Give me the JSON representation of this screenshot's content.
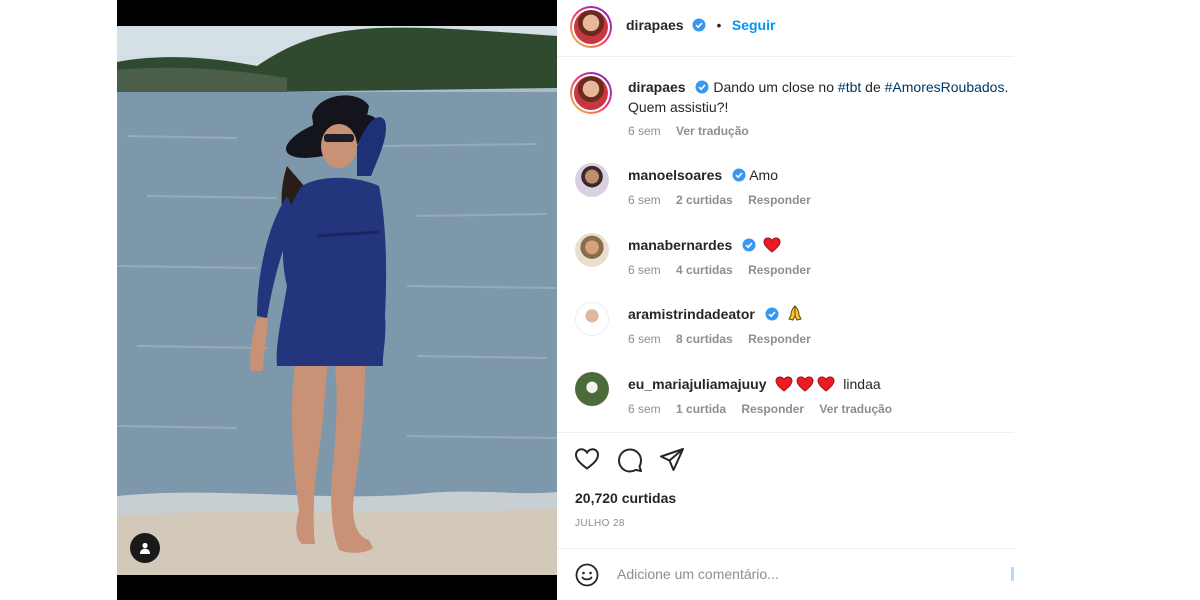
{
  "post": {
    "author": "dirapaes",
    "follow_label": "Seguir",
    "separator": "•",
    "caption": {
      "author": "dirapaes",
      "text_before": "Dando um close no ",
      "tag1": "#tbt",
      "text_mid": " de ",
      "tag2": "#AmoresRoubados",
      "text_after": ".",
      "line2": "Quem assistiu?!",
      "time": "6 sem",
      "translate": "Ver tradução"
    },
    "likes": "20,720 curtidas",
    "date": "JULHO 28",
    "add_comment_placeholder": "Adicione um comentário..."
  },
  "comments": [
    {
      "user": "manoelsoares",
      "text": "Amo",
      "time": "6 sem",
      "likes": "2 curtidas",
      "reply": "Responder",
      "hearts": 0
    },
    {
      "user": "manabernardes",
      "text": "",
      "time": "6 sem",
      "likes": "4 curtidas",
      "reply": "Responder",
      "hearts": 1
    },
    {
      "user": "aramistrindadeator",
      "text": "",
      "time": "6 sem",
      "likes": "8 curtidas",
      "reply": "Responder",
      "hearts": 0,
      "emoji": "pray-icon"
    },
    {
      "user": "eu_mariajuliamajuuy",
      "text": "lindaa",
      "time": "6 sem",
      "likes": "1 curtida",
      "reply": "Responder",
      "translate": "Ver tradução",
      "hearts": 3
    }
  ],
  "colors": {
    "link": "#0095f6",
    "hashtag": "#00376b",
    "muted": "#8e8e8e",
    "heart": "#ed1c24",
    "verified": "#3897f0"
  },
  "icons": [
    "heart-icon",
    "comment-icon",
    "share-icon",
    "emoji-icon",
    "user-tag-icon",
    "verified-icon"
  ]
}
